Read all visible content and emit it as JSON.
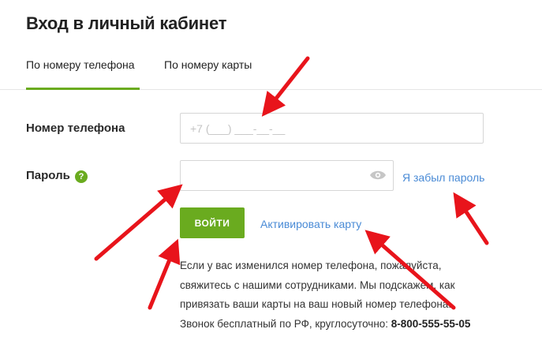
{
  "header": {
    "title": "Вход в личный кабинет"
  },
  "tabs": [
    {
      "label": "По номеру телефона",
      "active": true
    },
    {
      "label": "По номеру карты",
      "active": false
    }
  ],
  "form": {
    "phone_label": "Номер телефона",
    "phone_placeholder": "+7 (___) ___-__-__",
    "phone_value": "",
    "password_label": "Пароль",
    "password_value": "",
    "help_icon": "question-icon",
    "help_glyph": "?",
    "eye_icon": "eye-icon",
    "forgot_link": "Я забыл пароль",
    "login_button": "ВОЙТИ",
    "activate_link": "Активировать карту"
  },
  "info": {
    "line1": "Если у вас изменился номер телефона, пожалуйста,",
    "line2": "свяжитесь с нашими сотрудниками. Мы подскажем, как",
    "line3": "привязать ваши карты на ваш новый номер телефона.",
    "line4_prefix": "Звонок бесплатный по РФ, круглосуточно: ",
    "phone": "8-800-555-55-05"
  },
  "colors": {
    "accent_green": "#6aab1f",
    "link_blue": "#4a8bd6",
    "annotation_arrow": "#e8141b"
  }
}
